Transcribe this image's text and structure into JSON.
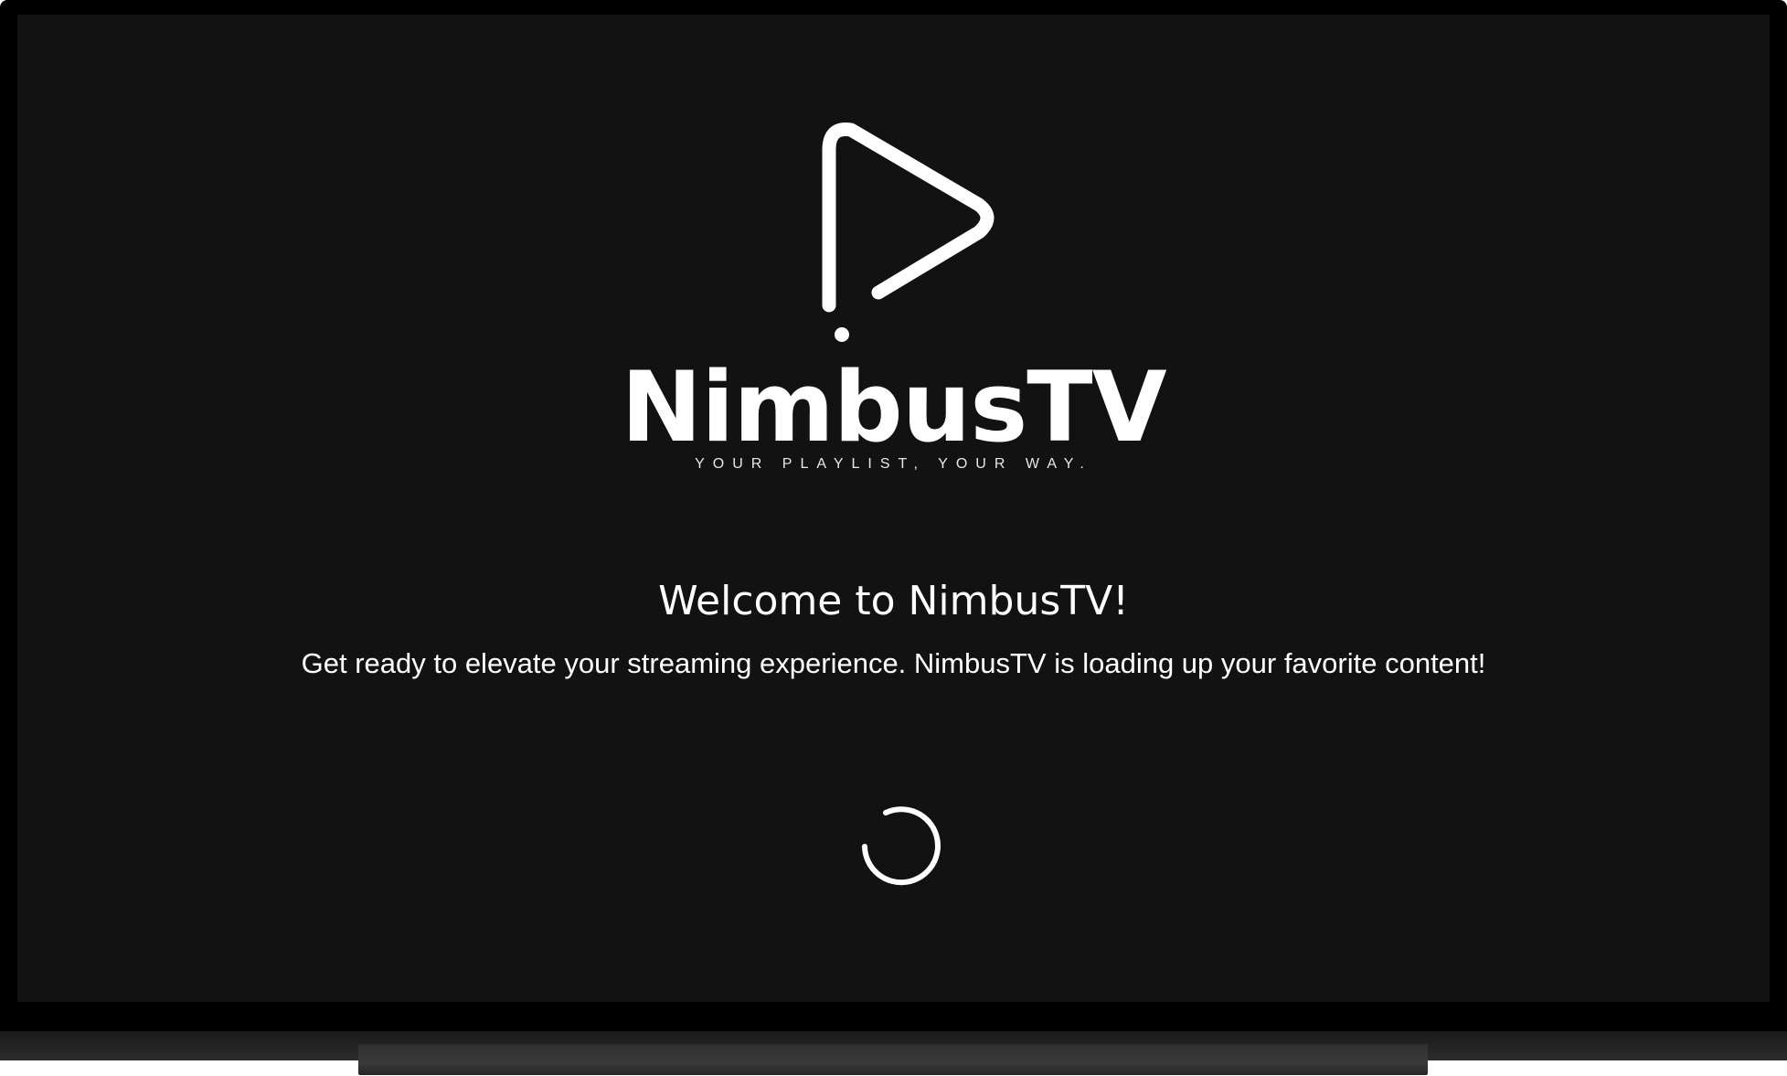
{
  "app": {
    "name": "NimbusTV",
    "tagline": "YOUR PLAYLIST, YOUR WAY."
  },
  "welcome": {
    "title": "Welcome to NimbusTV!",
    "subtitle": "Get ready to elevate your streaming experience. NimbusTV is loading up your favorite content!"
  },
  "icons": {
    "logo": "play-triangle-icon",
    "loading": "loading-spinner-icon"
  },
  "colors": {
    "screen_background": "#121212",
    "text": "#ffffff",
    "frame": "#000000"
  }
}
